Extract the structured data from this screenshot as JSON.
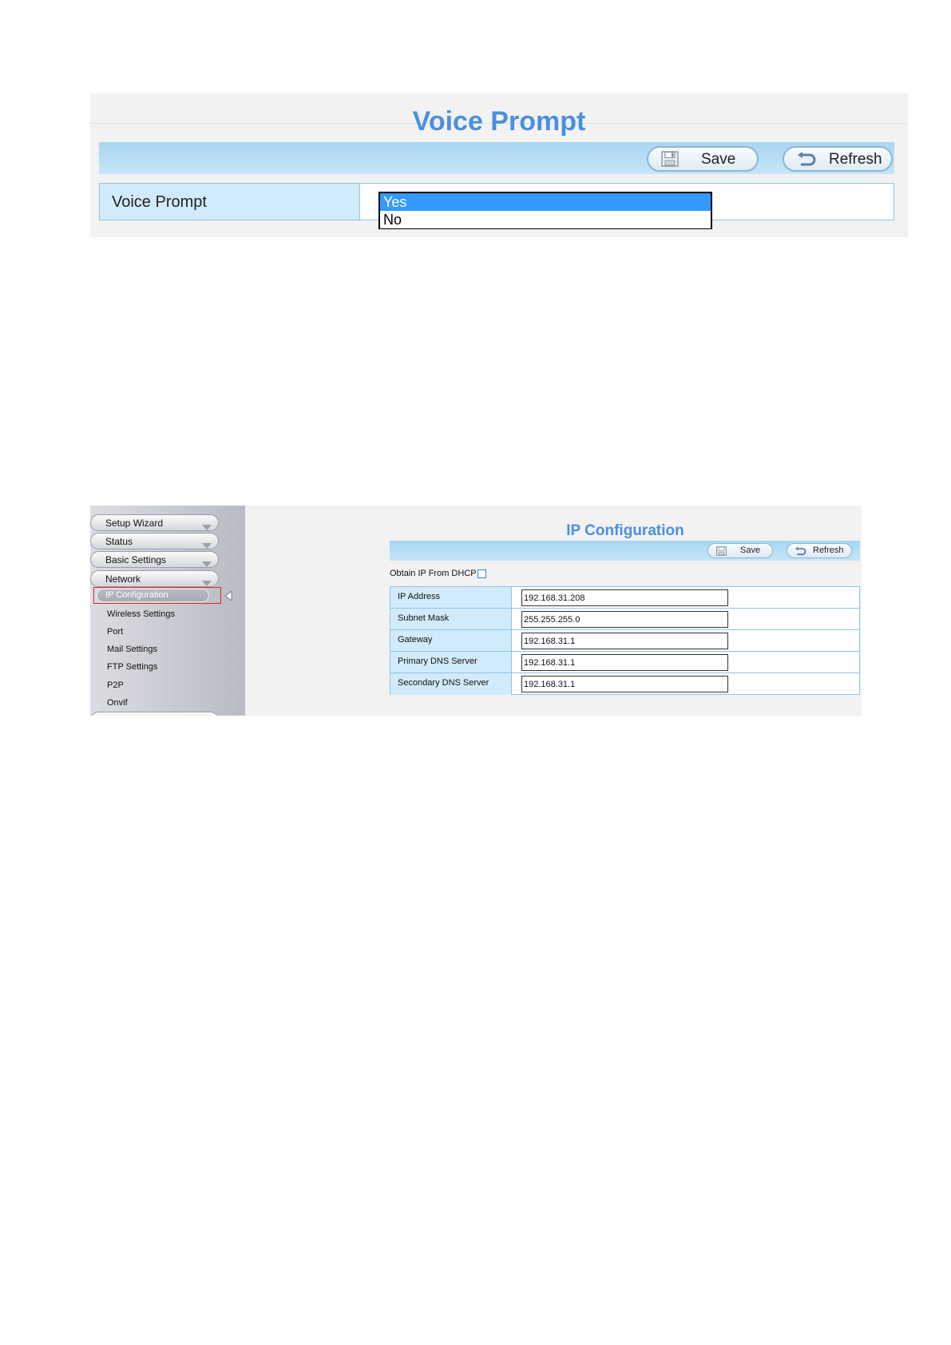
{
  "voice_prompt": {
    "title": "Voice Prompt",
    "toolbar": {
      "save_label": "Save",
      "refresh_label": "Refresh"
    },
    "row_label": "Voice Prompt",
    "options": [
      "Yes",
      "No"
    ],
    "selected": "Yes"
  },
  "ip_config": {
    "sidebar": {
      "menus": [
        "Setup Wizard",
        "Status",
        "Basic Settings",
        "Network"
      ],
      "network_items": [
        "IP Configuration",
        "Wireless Settings",
        "Port",
        "Mail Settings",
        "FTP Settings",
        "P2P",
        "Onvif"
      ],
      "active_item": "IP Configuration"
    },
    "title": "IP Configuration",
    "toolbar": {
      "save_label": "Save",
      "refresh_label": "Refresh"
    },
    "dhcp_label": "Obtain IP From DHCP",
    "dhcp_checked": false,
    "fields": [
      {
        "label": "IP Address",
        "value": "192.168.31.208"
      },
      {
        "label": "Subnet Mask",
        "value": "255.255.255.0"
      },
      {
        "label": "Gateway",
        "value": "192.168.31.1"
      },
      {
        "label": "Primary DNS Server",
        "value": "192.168.31.1"
      },
      {
        "label": "Secondary DNS Server",
        "value": "192.168.31.1"
      }
    ]
  },
  "colors": {
    "title_blue": "#4a8fe0",
    "toolbar_blue": "#a7d6f2",
    "label_cell": "#d2ebfa",
    "border_blue": "#8ec4e8",
    "selection_blue": "#3399ff",
    "highlight_red": "#e0272e"
  }
}
